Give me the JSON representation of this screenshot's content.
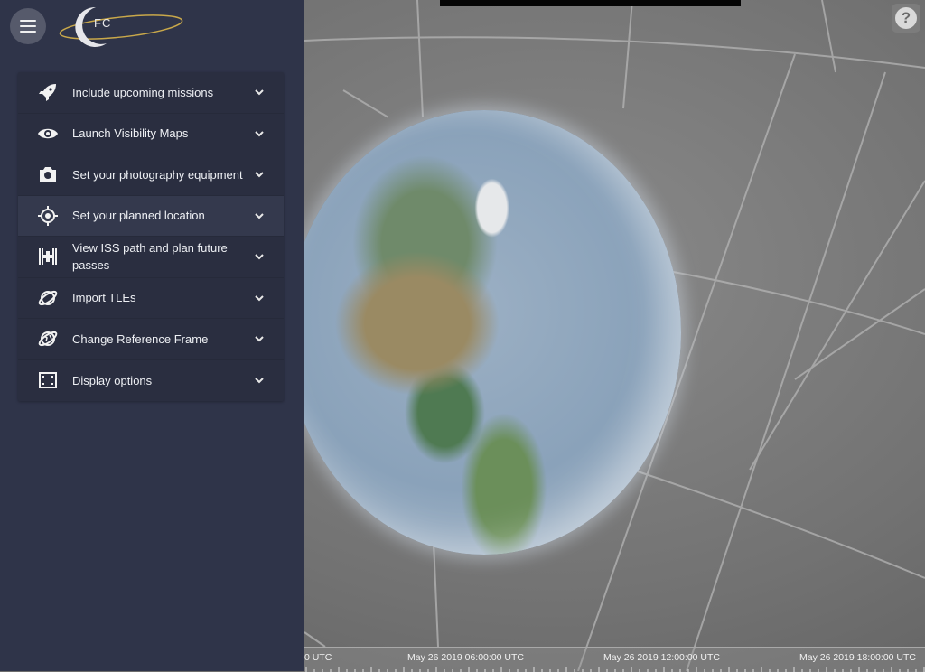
{
  "app": {
    "logo_text": "FC"
  },
  "sidebar": {
    "items": [
      {
        "label": "Include upcoming missions",
        "icon": "rocket-icon"
      },
      {
        "label": "Launch Visibility Maps",
        "icon": "eye-icon"
      },
      {
        "label": "Set your photography equipment",
        "icon": "camera-icon"
      },
      {
        "label": "Set your planned location",
        "icon": "crosshair-icon"
      },
      {
        "label": "View ISS path and plan future passes",
        "icon": "satellite-icon"
      },
      {
        "label": "Import TLEs",
        "icon": "orbit-icon"
      },
      {
        "label": "Change Reference Frame",
        "icon": "globe-orbit-icon"
      },
      {
        "label": "Display options",
        "icon": "display-frame-icon"
      }
    ]
  },
  "help": {
    "label": "?"
  },
  "timeline": {
    "labels": [
      "0 UTC",
      "May 26 2019 06:00:00 UTC",
      "May 26 2019 12:00:00 UTC",
      "May 26 2019 18:00:00 UTC"
    ]
  },
  "colors": {
    "sidebar": "#2f3449",
    "accordion": "#2a2e40",
    "highlight": "#34394d",
    "logo_orbit": "#c9a84a"
  }
}
